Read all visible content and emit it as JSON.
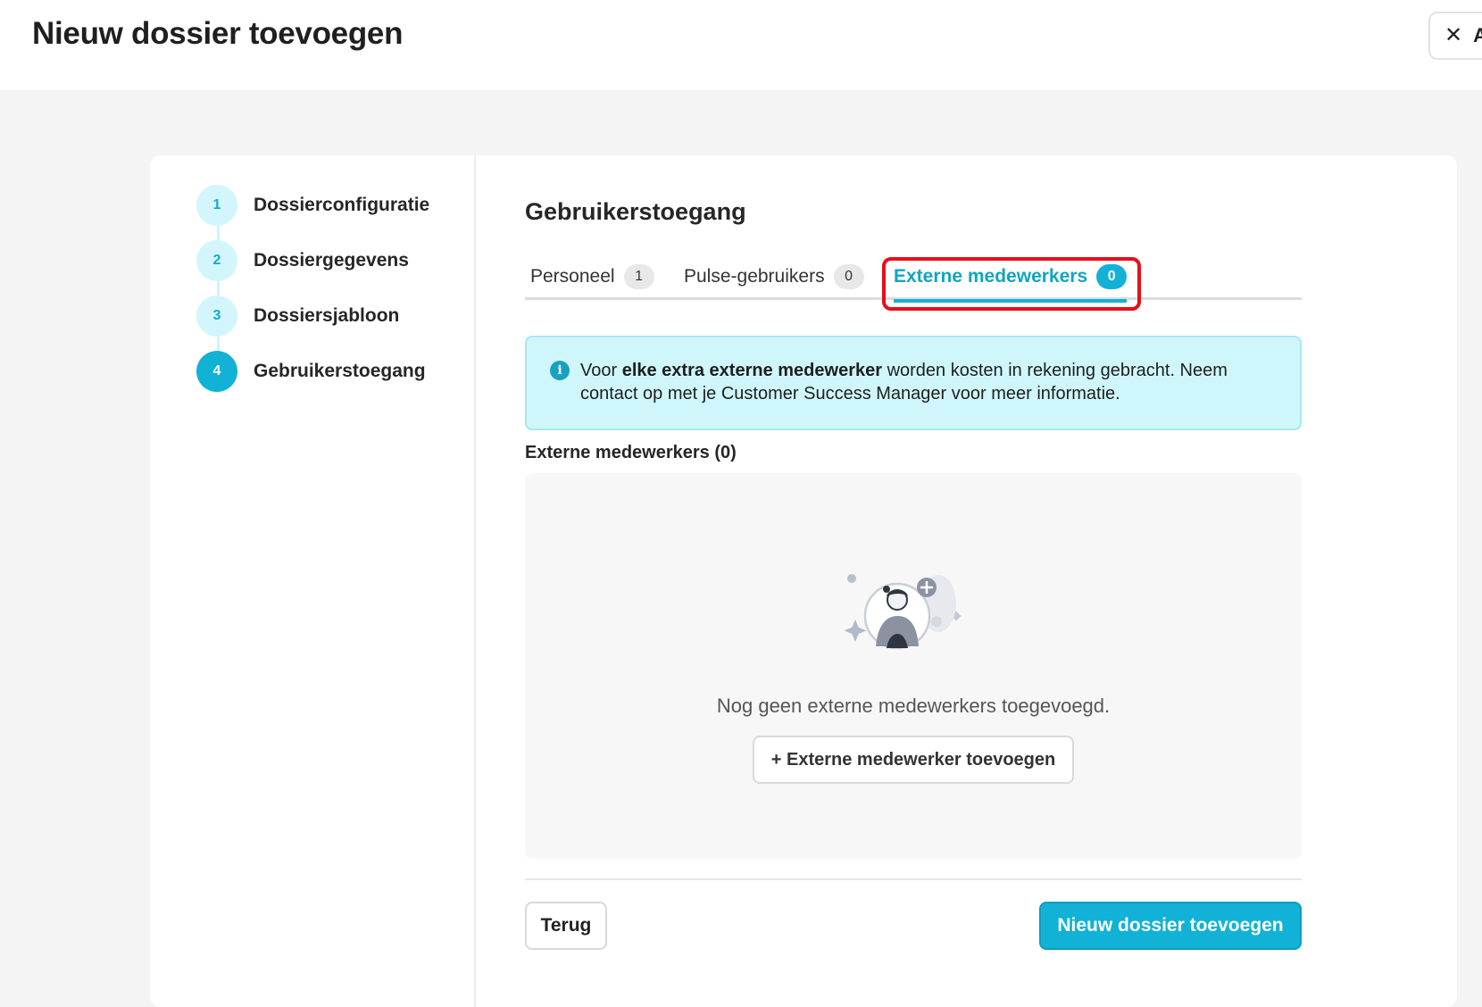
{
  "header": {
    "title": "Nieuw dossier toevoegen",
    "close_label": "A"
  },
  "stepper": {
    "steps": [
      {
        "number": "1",
        "label": "Dossierconfiguratie"
      },
      {
        "number": "2",
        "label": "Dossiergegevens"
      },
      {
        "number": "3",
        "label": "Dossiersjabloon"
      },
      {
        "number": "4",
        "label": "Gebruikerstoegang"
      }
    ],
    "active_step": 4
  },
  "main": {
    "section_title": "Gebruikerstoegang",
    "tabs": [
      {
        "label": "Personeel",
        "count": "1"
      },
      {
        "label": "Pulse-gebruikers",
        "count": "0"
      },
      {
        "label": "Externe medewerkers",
        "count": "0",
        "active": true
      }
    ],
    "info": {
      "prefix": "Voor ",
      "bold": "elke extra externe medewerker",
      "suffix": " worden kosten in rekening gebracht. Neem contact op met je Customer Success Manager voor meer informatie."
    },
    "list_title": "Externe medewerkers (0)",
    "empty_text": "Nog geen externe medewerkers toegevoegd.",
    "add_button_label": "+ Externe medewerker toevoegen"
  },
  "footer": {
    "back_label": "Terug",
    "submit_label": "Nieuw dossier toevoegen"
  },
  "colors": {
    "accent": "#12b2d6",
    "info_bg": "#cff7fb",
    "highlight": "#e5101a"
  }
}
